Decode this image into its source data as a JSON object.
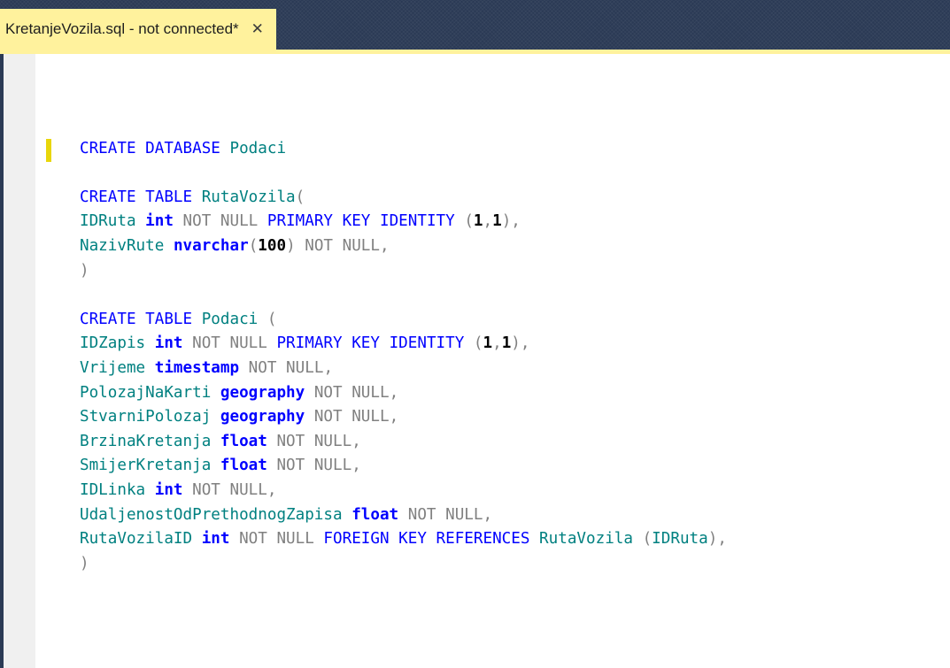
{
  "tab": {
    "title": "KretanjeVozila.sql - not connected*",
    "close_glyph": "✕",
    "active_color": "#fff29d"
  },
  "editor": {
    "code_lines": [
      [],
      [
        {
          "t": "CREATE DATABASE",
          "c": "kw"
        },
        {
          "t": " Podaci",
          "c": "id"
        }
      ],
      [],
      [
        {
          "t": "CREATE TABLE",
          "c": "kw"
        },
        {
          "t": " RutaVozila",
          "c": "id"
        },
        {
          "t": "(",
          "c": "pn"
        }
      ],
      [
        {
          "t": "IDRuta ",
          "c": "id"
        },
        {
          "t": "int",
          "c": "ty"
        },
        {
          "t": " NOT NULL ",
          "c": "gr"
        },
        {
          "t": "PRIMARY KEY IDENTITY",
          "c": "kw"
        },
        {
          "t": " (",
          "c": "pn"
        },
        {
          "t": "1",
          "c": "nm"
        },
        {
          "t": ",",
          "c": "pn"
        },
        {
          "t": "1",
          "c": "nm"
        },
        {
          "t": "),",
          "c": "pn"
        }
      ],
      [
        {
          "t": "NazivRute ",
          "c": "id"
        },
        {
          "t": "nvarchar",
          "c": "ty"
        },
        {
          "t": "(",
          "c": "pn"
        },
        {
          "t": "100",
          "c": "nm"
        },
        {
          "t": ")",
          "c": "pn"
        },
        {
          "t": " NOT NULL",
          "c": "gr"
        },
        {
          "t": ",",
          "c": "pn"
        }
      ],
      [
        {
          "t": ")",
          "c": "pn"
        }
      ],
      [],
      [
        {
          "t": "CREATE TABLE",
          "c": "kw"
        },
        {
          "t": " Podaci ",
          "c": "id"
        },
        {
          "t": "(",
          "c": "pn"
        }
      ],
      [
        {
          "t": "IDZapis ",
          "c": "id"
        },
        {
          "t": "int",
          "c": "ty"
        },
        {
          "t": " NOT NULL ",
          "c": "gr"
        },
        {
          "t": "PRIMARY KEY IDENTITY",
          "c": "kw"
        },
        {
          "t": " (",
          "c": "pn"
        },
        {
          "t": "1",
          "c": "nm"
        },
        {
          "t": ",",
          "c": "pn"
        },
        {
          "t": "1",
          "c": "nm"
        },
        {
          "t": "),",
          "c": "pn"
        }
      ],
      [
        {
          "t": "Vrijeme ",
          "c": "id"
        },
        {
          "t": "timestamp",
          "c": "ty"
        },
        {
          "t": " NOT NULL",
          "c": "gr"
        },
        {
          "t": ",",
          "c": "pn"
        }
      ],
      [
        {
          "t": "PolozajNaKarti ",
          "c": "id"
        },
        {
          "t": "geography",
          "c": "ty"
        },
        {
          "t": " NOT NULL",
          "c": "gr"
        },
        {
          "t": ",",
          "c": "pn"
        }
      ],
      [
        {
          "t": "StvarniPolozaj ",
          "c": "id"
        },
        {
          "t": "geography",
          "c": "ty"
        },
        {
          "t": " NOT NULL",
          "c": "gr"
        },
        {
          "t": ",",
          "c": "pn"
        }
      ],
      [
        {
          "t": "BrzinaKretanja ",
          "c": "id"
        },
        {
          "t": "float",
          "c": "ty"
        },
        {
          "t": " NOT NULL",
          "c": "gr"
        },
        {
          "t": ",",
          "c": "pn"
        }
      ],
      [
        {
          "t": "SmijerKretanja ",
          "c": "id"
        },
        {
          "t": "float",
          "c": "ty"
        },
        {
          "t": " NOT NULL",
          "c": "gr"
        },
        {
          "t": ",",
          "c": "pn"
        }
      ],
      [
        {
          "t": "IDLinka ",
          "c": "id"
        },
        {
          "t": "int",
          "c": "ty"
        },
        {
          "t": " NOT NULL",
          "c": "gr"
        },
        {
          "t": ",",
          "c": "pn"
        }
      ],
      [
        {
          "t": "UdaljenostOdPrethodnogZapisa ",
          "c": "id"
        },
        {
          "t": "float",
          "c": "ty"
        },
        {
          "t": " NOT NULL",
          "c": "gr"
        },
        {
          "t": ",",
          "c": "pn"
        }
      ],
      [
        {
          "t": "RutaVozilaID ",
          "c": "id"
        },
        {
          "t": "int",
          "c": "ty"
        },
        {
          "t": " NOT NULL ",
          "c": "gr"
        },
        {
          "t": "FOREIGN KEY REFERENCES",
          "c": "kw"
        },
        {
          "t": " RutaVozila ",
          "c": "id"
        },
        {
          "t": "(",
          "c": "pn"
        },
        {
          "t": "IDRuta",
          "c": "id"
        },
        {
          "t": "),",
          "c": "pn"
        }
      ],
      [
        {
          "t": ")",
          "c": "pn"
        }
      ]
    ]
  },
  "colors": {
    "keyword": "#0000ff",
    "identifier": "#008080",
    "null_keyword": "#808080",
    "number": "#000000",
    "tab_strip": "#2b3a55",
    "change_marker": "#e8d60a"
  }
}
